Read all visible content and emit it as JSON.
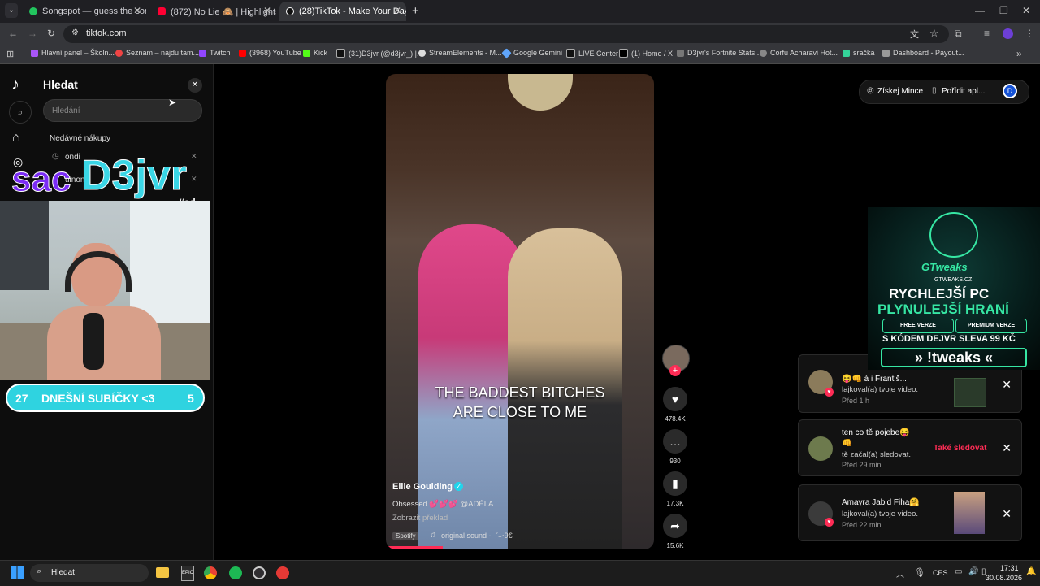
{
  "browser": {
    "tabs": [
      {
        "title": "Songspot — guess the song",
        "active": false
      },
      {
        "title": "(872) No Lie 🙈 | Highlights #9",
        "active": false
      },
      {
        "title": "(28)TikTok - Make Your Day",
        "active": true
      }
    ],
    "new_tab": "+",
    "url": "tiktok.com",
    "bookmarks": [
      "Hlavní panel – Školn...",
      "Seznam – najdu tam...",
      "Twitch",
      "(3968) YouTube",
      "Kick",
      "(31)D3jvr (@d3jvr_) |...",
      "StreamElements - M...",
      "Google Gemini",
      "LIVE Center",
      "(1) Home / X",
      "D3jvr's Fortnite Stats...",
      "Corfu Acharavi Hot...",
      "sračka",
      "Dashboard - Payout..."
    ]
  },
  "sidebar": {
    "title": "Hledat",
    "search_placeholder": "Hledání",
    "recent_purchases": "Nedávné nákupy",
    "history": [
      "ondi",
      "uinon"
    ]
  },
  "stream_overlay": {
    "name_left": "sac",
    "name_right": "D3jvr",
    "ad_tag": "#ad",
    "sub_left": "27",
    "sub_label": "DNEŠNÍ SUBÍČKY <3",
    "sub_right": "5"
  },
  "video": {
    "caption_line1": "THE BADDEST BITCHES",
    "caption_line2": "ARE CLOSE TO ME",
    "author": "Ellie Goulding",
    "description": "Obsessed 💕💕💕 @ADÉLA",
    "translate": "Zobrazit překlad",
    "spotify": "Spotify",
    "sound": "original sound - ·˚₊‧9€"
  },
  "actions": {
    "likes": "478.4K",
    "comments": "930",
    "saves": "17.3K",
    "shares": "15.6K"
  },
  "top_right": {
    "coins": "Získej Mince",
    "app": "Pořídit apl..."
  },
  "ad": {
    "brand": "GTweaks",
    "domain": "GTWEAKS.CZ",
    "line1": "RYCHLEJŠÍ PC",
    "line2": "PLYNULEJŠÍ HRANÍ",
    "free": "FREE VERZE",
    "premium": "PREMIUM VERZE",
    "code": "S KÓDEM DEJVR SLEVA 99 KČ",
    "command": "» !tweaks «"
  },
  "notifications": [
    {
      "title": "😝👊 á i Františ...",
      "text": "lajkoval(a) tvoje video.",
      "time": "Před 1 h"
    },
    {
      "title": "ten co tě pojebe😝",
      "title2": "👊",
      "text": "tě začal(a) sledovat.",
      "time": "Před 29 min",
      "action": "Také sledovat"
    },
    {
      "title": "Amayra Jabid Fiha🤗",
      "text": "lajkoval(a) tvoje video.",
      "time": "Před 22 min"
    }
  ],
  "taskbar": {
    "search": "Hledat",
    "lang": "CES",
    "time": "17:31",
    "date": "30.08.2026"
  },
  "colors": {
    "accent_pink": "#fe2c55",
    "overlay_cyan": "#2fd3e0",
    "name_purple": "#7b2cf5",
    "ad_green": "#36e6a3"
  }
}
